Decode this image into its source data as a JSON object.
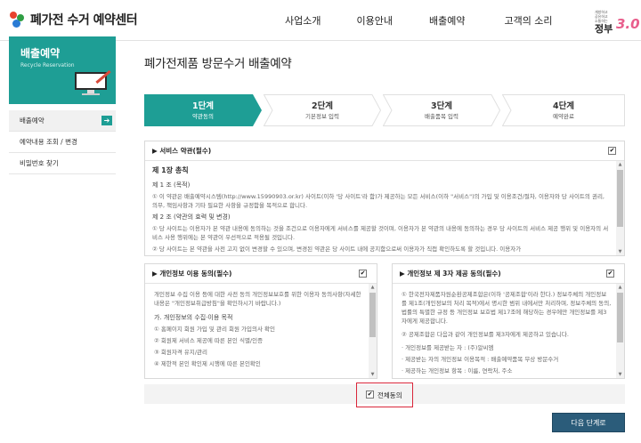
{
  "header": {
    "logo_text": "폐가전 수거 예약센터",
    "nav": [
      "사업소개",
      "이용안내",
      "배출예약",
      "고객의 소리"
    ],
    "gov_logo": {
      "small": "개방하고 공유하고 소통하는",
      "main": "정부",
      "version": "3.0"
    }
  },
  "sidebar": {
    "title": "배출예약",
    "subtitle": "Recycle Reservation",
    "items": [
      {
        "label": "배출예약",
        "active": true
      },
      {
        "label": "예약내용 조회 / 변경",
        "active": false
      },
      {
        "label": "비밀번호 찾기",
        "active": false
      }
    ]
  },
  "main": {
    "title": "폐가전제품 방문수거 배출예약",
    "steps": [
      {
        "num": "1단계",
        "label": "약관동의",
        "active": true
      },
      {
        "num": "2단계",
        "label": "기본정보 입력",
        "active": false
      },
      {
        "num": "3단계",
        "label": "배출품목 입력",
        "active": false
      },
      {
        "num": "4단계",
        "label": "예약완료",
        "active": false
      }
    ],
    "service_terms": {
      "heading": "▶ 서비스 약관(필수)",
      "chapter": "제 1장 총칙",
      "art1_title": "제 1 조 (목적)",
      "art1_text": "① 이 약관은 배출예약시스템(http://www.15990903.or.kr) 사이트(이하 '당 사이트'라 함)가 제공하는 모든 서비스(이하 \"서비스\")의 가입 및 이용조건/절차, 이용자와 당 사이트의 권리, 의무, 책임사항과 기타 필요한 사항을 규정함을 목적으로 합니다.",
      "art2_title": "제 2 조 (약관의 효력 및 변경)",
      "art2_text": "① 당 사이트는 이용자가 본 약관 내용에 동의하는 것을 조건으로 이용자에게 서비스를 제공할 것이며, 이용자가 본 약관의 내용에 동의하는 경우 당 사이트의 서비스 제공 행위 및 이용자의 서비스 사용 행위에는 본 약관이 우선적으로 적용될 것입니다.",
      "art2_text2": "② 당 사이트는 본 약관을 사전 고지 없이 변경할 수 있으며, 변경된 약관은 당 사이트 내에 공지함으로써 이용자가 직접 확인하도록 할 것입니다. 이용자가",
      "checked": true
    },
    "privacy": {
      "heading": "▶ 개인정보 이용 동의(필수)",
      "text1": "개인정보 수집 이용 등에 대한 사전 동의 개인정보보호를 위한 이용자 동의사항(자세한 내용은 \"개인정보취급방침\"을 확인하시기 바랍니다.)",
      "sub": "가. 개인정보의 수집·이용 목적",
      "items": [
        "① 홈페이지 회원 가입 및 관리 회원 가입의사 확인",
        "② 회원제 서비스 제공에 따른 본인 식별/인증",
        "③ 회원자격 유지/관리",
        "④ 제한적 본인 확인제 시행에 따른 본인확인"
      ],
      "checked": true
    },
    "third_party": {
      "heading": "▶ 개인정보 제 3자 제공 동의(필수)",
      "text1": "① 한국전자제품자원순환공제조합은(이하 '공제조합'이라 한다.) 정보주체의 개인정보를 제1조(개인정보의 처리 목적)에서 명시한 범위 내에서만 처리하며, 정보주체의 동의, 법률의 특별한 규정 등 개인정보 보호법 제17조에 해당하는 경우에만 개인정보를 제3자에게 제공합니다.",
      "text2": "② 공제조합은 다음과 같이 개인정보를 제3자에게 제공하고 있습니다.",
      "items": [
        "· 개인정보를 제공받는 자 : (주)알씨엠",
        "· 제공받는 자의 개인정보 이용목적 : 배출예약품목 무상 방문수거",
        "· 제공하는 개인정보 항목 : 이름, 연락처, 주소"
      ],
      "checked": true
    },
    "agree_all": {
      "label": "전체동의",
      "checked": true
    },
    "next_button": "다음 단계로"
  }
}
